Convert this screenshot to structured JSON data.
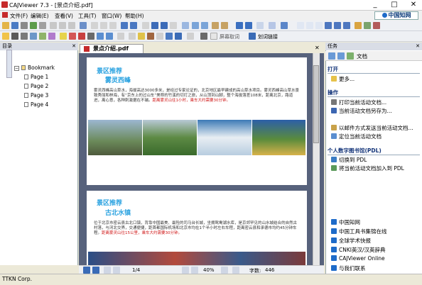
{
  "window": {
    "title": "CAJViewer 7.3 - [景点介绍.pdf]",
    "brand": "中国知网",
    "controls": [
      "_",
      "□",
      "✕"
    ]
  },
  "menu": [
    "文件(F)",
    "编辑(E)",
    "查看(V)",
    "工具(T)",
    "窗口(W)",
    "帮助(H)"
  ],
  "toolbar": {
    "text_buttons": [
      "屏幕取词",
      "划词链接"
    ]
  },
  "left_panel": {
    "title": "目录",
    "bookmark": "Bookmark",
    "pages": [
      "Page 1",
      "Page 2",
      "Page 3",
      "Page 4"
    ]
  },
  "doc_tab": "景点介绍.pdf",
  "page1": {
    "section": "景区推荐",
    "title": "雾灵西峰",
    "para": "雾灵西峰高山草水，海拔高达3000多米，是经过专家论证的，北京地区最早建成的高山草水项目。雾灵西峰高山草水景致秀丽和林海，有“京东上的过山车”美称的竹溪的切打之旅，从山顶到山脚，整个海拔落差108米，距离北京，路道进，离心意，各种刺激据在不端。",
    "highlight": "距离雾灵山往1小时，乘车大约需要30分钟。"
  },
  "page2": {
    "section": "景区推荐",
    "title": "古北水镇",
    "para": "位于北京市密云县古北口镇，背靠中国最美、最险的司马台长城，坐拥鸳鸯湖水库，是京郊罕见的山水城结合的自然古村落，与河北交界，交通便捷，距首都国际机场和北京市均在1个半小时左右车程，距离密云县和承德市均约45分钟车程。",
    "highlight": "距离雾灵山往15公里，乘车大约需要30分钟。"
  },
  "status": {
    "page": "1/4",
    "zoom": "40%",
    "chars_label": "字数:",
    "chars": "446"
  },
  "bottom": "TTKN Corp.",
  "right_panel": {
    "title": "任务",
    "dropdown": "文档",
    "sections": [
      {
        "title": "打开",
        "items": [
          "更多..."
        ]
      },
      {
        "title": "操作",
        "items": [
          "打印当前活动文档...",
          "当前活动文档另存为..."
        ]
      },
      {
        "title": "",
        "items": [
          "以邮件方式发送当前活动文档...",
          "定位当前活动文档"
        ]
      },
      {
        "title": "个人数字图书馆(PDL)",
        "items": [
          "切换到 PDL",
          "将当前活动文档加入到 PDL"
        ]
      }
    ],
    "links": [
      "中国知网",
      "中国工具书集锦在线",
      "全球学术快报",
      "CNKI英汉/汉英辞典",
      "CAJViewer Online",
      "与我们联系"
    ]
  }
}
